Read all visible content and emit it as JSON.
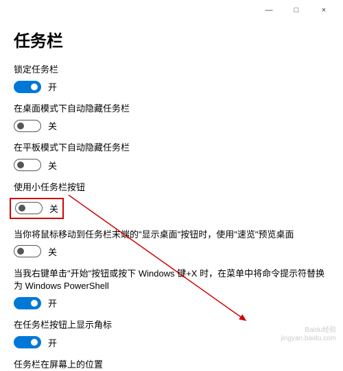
{
  "window": {
    "title": "任务栏"
  },
  "titlebar": {
    "minimize": "—",
    "maximize": "□",
    "close": "×"
  },
  "toggleStates": {
    "on": "开",
    "off": "关"
  },
  "settings": [
    {
      "label": "锁定任务栏",
      "state": "on",
      "highlight": false
    },
    {
      "label": "在桌面模式下自动隐藏任务栏",
      "state": "off",
      "highlight": false
    },
    {
      "label": "在平板模式下自动隐藏任务栏",
      "state": "off",
      "highlight": false
    },
    {
      "label": "使用小任务栏按钮",
      "state": "off",
      "highlight": true
    },
    {
      "label": "当你将鼠标移动到任务栏末端的\"显示桌面\"按钮时，使用\"速览\"预览桌面",
      "state": "off",
      "highlight": false
    },
    {
      "label": "当我右键单击\"开始\"按钮或按下 Windows 键+X 时，在菜单中将命令提示符替换为 Windows PowerShell",
      "state": "on",
      "highlight": false
    },
    {
      "label": "在任务栏按钮上显示角标",
      "state": "on",
      "highlight": false
    }
  ],
  "footer": {
    "locationLabel": "任务栏在屏幕上的位置"
  },
  "watermark": {
    "brand": "Baidu经验",
    "site": "jingyan.baidu.com"
  }
}
